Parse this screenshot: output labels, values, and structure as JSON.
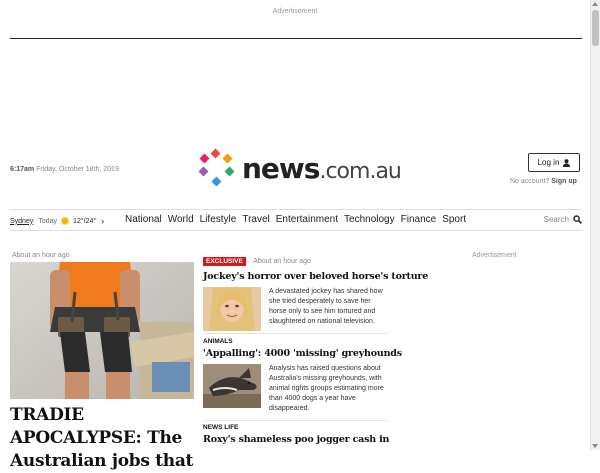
{
  "ads": {
    "top_label": "Advertisement",
    "right_label": "Advertisement"
  },
  "header": {
    "time": "6:17am",
    "date": "Friday, October 18th, 2019",
    "logo_main": "news",
    "logo_tld": ".com.au",
    "login_label": "Log in",
    "no_account": "No account?",
    "signup": "Sign up"
  },
  "nav": {
    "city": "Sydney",
    "day": "Today",
    "temps": "12°/24°",
    "links": [
      "National",
      "World",
      "Lifestyle",
      "Travel",
      "Entertainment",
      "Technology",
      "Finance",
      "Sport"
    ],
    "search_label": "Search"
  },
  "lead": {
    "time": "About an hour ago",
    "headline": "TRADIE APOCALYPSE: The Australian jobs that"
  },
  "stories": [
    {
      "badge": "EXCLUSIVE",
      "time": "About an hour ago",
      "title": "Jockey's horror over beloved horse's torture",
      "summary": "A devastated jockey has shared how she tried desperately to save her horse only to see him tortured and slaughtered on national television."
    },
    {
      "kicker": "ANIMALS",
      "title": "'Appalling': 4000 'missing' greyhounds",
      "summary": "Analysis has raised questions about Australia's missing greyhounds, with animal rights groups estimating more than 4000 dogs a year have disappeared."
    },
    {
      "kicker": "NEWS LIFE",
      "title": "Roxy's shameless poo jogger cash in"
    }
  ],
  "colors": {
    "exclusive_red": "#d01c1f",
    "logo_dots": [
      "#e94b3c",
      "#9b59b6",
      "#3498db",
      "#27ae60",
      "#f39c12",
      "#e67e22"
    ]
  }
}
